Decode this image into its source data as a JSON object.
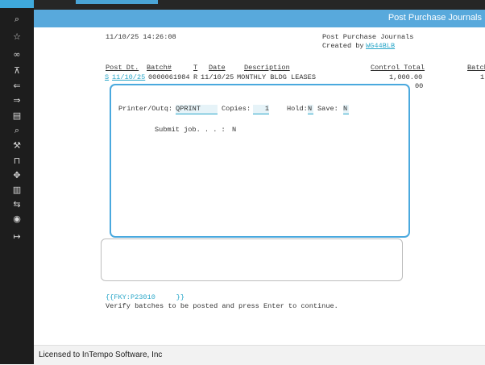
{
  "window": {
    "title": "Post Purchase Journals"
  },
  "sidebar": {
    "icons": [
      "search-icon",
      "star-icon",
      "link-icon",
      "cart-icon",
      "send-back-icon",
      "send-forward-icon",
      "clipboard-icon",
      "inspect-icon",
      "wrench-icon",
      "lock-icon",
      "move-icon",
      "trash-icon",
      "transfer-icon",
      "eye-icon",
      "logout-icon"
    ]
  },
  "report": {
    "timestamp": "11/10/25 14:26:08",
    "heading": "Post Purchase Journals",
    "created_by_label": "Created by",
    "created_by_user": "WG44BLB",
    "columns": [
      "Post Dt.",
      "Batch#",
      "T",
      "Date",
      "Description",
      "Control Total",
      "Batch"
    ],
    "row": {
      "sel": "S",
      "post_dt": "11/10/25",
      "batch": "0000061984",
      "type": "R",
      "date": "11/10/25",
      "description": "MONTHLY BLDG LEASES",
      "control_total": "1,000.00",
      "batch_partial": "1"
    },
    "second_row_tail": "00"
  },
  "popup": {
    "printer_label": "Printer/Outq:",
    "printer_value": "QPRINT",
    "copies_label": "Copies:",
    "copies_value": "1",
    "hold_label": "Hold:",
    "hold_value": "N",
    "save_label": "Save:",
    "save_value": "N",
    "submit_label": "Submit job. . . :",
    "submit_value": "N"
  },
  "fkeys": {
    "text": "{{FKY:P23010     }}"
  },
  "message": "Verify batches to be posted and press Enter to continue.",
  "footer": {
    "license": "Licensed to InTempo Software, Inc"
  },
  "colors": {
    "accent": "#58a9dc",
    "link": "#2aa7c9",
    "sidebar": "#1d1d1d"
  }
}
